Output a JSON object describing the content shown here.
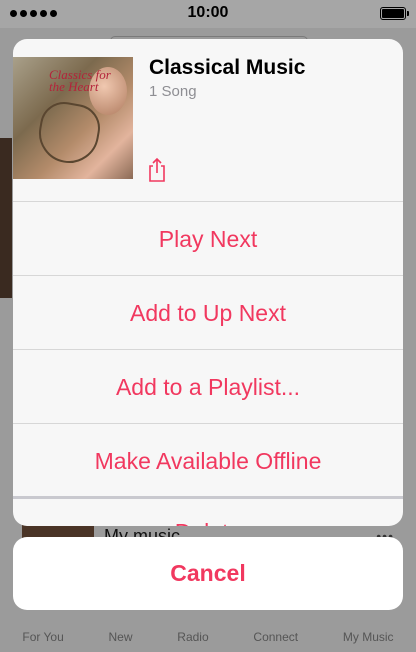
{
  "status_bar": {
    "time": "10:00"
  },
  "background": {
    "row_title": "My music",
    "row_more": "•••",
    "tabs": [
      "For You",
      "New",
      "Radio",
      "Connect",
      "My Music"
    ]
  },
  "artwork": {
    "title_text": "Classics for the Heart"
  },
  "sheet": {
    "title": "Classical Music",
    "subtitle": "1 Song",
    "items": [
      {
        "label": "Play Next"
      },
      {
        "label": "Add to Up Next"
      },
      {
        "label": "Add to a Playlist..."
      },
      {
        "label": "Make Available Offline"
      },
      {
        "label": "Delete"
      }
    ],
    "cancel_label": "Cancel"
  },
  "colors": {
    "accent": "#f1385f",
    "overlay": "#9b9b9b",
    "sheet_bg": "#f7f7f7"
  },
  "icons": {
    "share": "share-icon"
  }
}
